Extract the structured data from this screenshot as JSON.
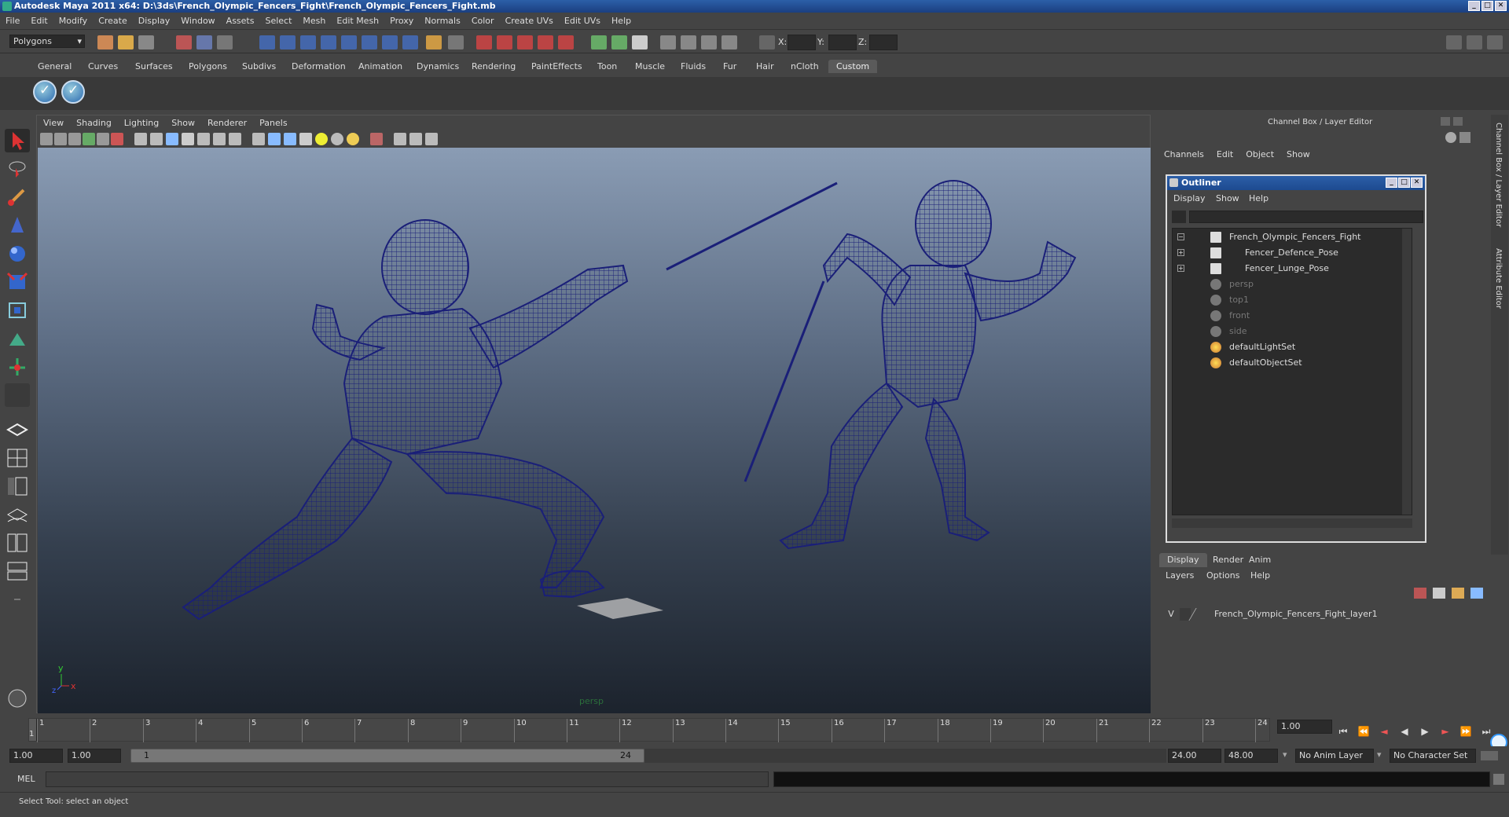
{
  "window": {
    "title": "Autodesk Maya 2011 x64: D:\\3ds\\French_Olympic_Fencers_Fight\\French_Olympic_Fencers_Fight.mb"
  },
  "menu": [
    "File",
    "Edit",
    "Modify",
    "Create",
    "Display",
    "Window",
    "Assets",
    "Select",
    "Mesh",
    "Edit Mesh",
    "Proxy",
    "Normals",
    "Color",
    "Create UVs",
    "Edit UVs",
    "Help"
  ],
  "statusline": {
    "mode": "Polygons",
    "x_label": "X:",
    "y_label": "Y:",
    "z_label": "Z:"
  },
  "shelf": {
    "tabs": [
      "General",
      "Curves",
      "Surfaces",
      "Polygons",
      "Subdivs",
      "Deformation",
      "Animation",
      "Dynamics",
      "Rendering",
      "PaintEffects",
      "Toon",
      "Muscle",
      "Fluids",
      "Fur",
      "Hair",
      "nCloth",
      "Custom"
    ],
    "active": "Custom"
  },
  "viewport": {
    "menu": [
      "View",
      "Shading",
      "Lighting",
      "Show",
      "Renderer",
      "Panels"
    ],
    "camera_label": "persp",
    "axis_y": "y",
    "axis_x": "x",
    "axis_z": "z"
  },
  "channelbox": {
    "title": "Channel Box / Layer Editor",
    "menu": [
      "Channels",
      "Edit",
      "Object",
      "Show"
    ],
    "side_tabs": [
      "Channel Box / Layer Editor",
      "Attribute Editor"
    ]
  },
  "outliner": {
    "title": "Outliner",
    "menu": [
      "Display",
      "Show",
      "Help"
    ],
    "items": [
      {
        "label": "French_Olympic_Fencers_Fight",
        "dim": false
      },
      {
        "label": "Fencer_Defence_Pose",
        "dim": false
      },
      {
        "label": "Fencer_Lunge_Pose",
        "dim": false
      },
      {
        "label": "persp",
        "dim": true
      },
      {
        "label": "top1",
        "dim": true
      },
      {
        "label": "front",
        "dim": true
      },
      {
        "label": "side",
        "dim": true
      },
      {
        "label": "defaultLightSet",
        "dim": false
      },
      {
        "label": "defaultObjectSet",
        "dim": false
      }
    ]
  },
  "layers": {
    "tabs": [
      "Display",
      "Render",
      "Anim"
    ],
    "menu": [
      "Layers",
      "Options",
      "Help"
    ],
    "layer_visible": "V",
    "layer_name": "French_Olympic_Fencers_Fight_layer1"
  },
  "timeline": {
    "ticks": [
      "1",
      "2",
      "3",
      "4",
      "5",
      "6",
      "7",
      "8",
      "9",
      "10",
      "11",
      "12",
      "13",
      "14",
      "15",
      "16",
      "17",
      "18",
      "19",
      "20",
      "21",
      "22",
      "23",
      "24"
    ],
    "current_frame": "1.00",
    "current_marker": "1"
  },
  "range": {
    "start": "1.00",
    "playback_start": "1.00",
    "slider_start": "1",
    "slider_end": "24",
    "playback_end": "24.00",
    "end": "48.00",
    "anim_layer": "No Anim Layer",
    "character_set": "No Character Set"
  },
  "command": {
    "label": "MEL"
  },
  "help": {
    "text": "Select Tool: select an object"
  },
  "colors": {
    "wire": "#1a1f78",
    "title_blue": "#2c5fa8"
  }
}
